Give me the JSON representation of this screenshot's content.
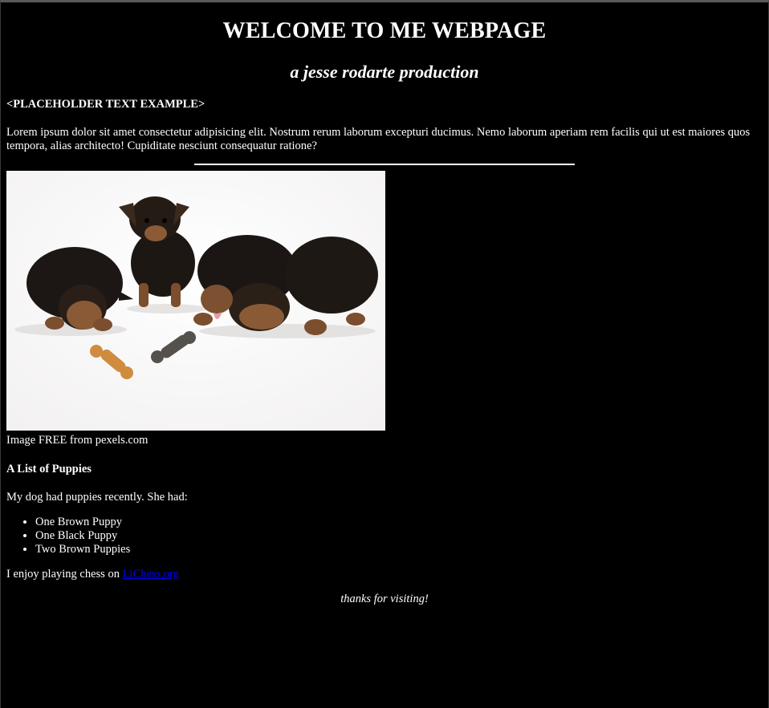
{
  "header": {
    "title": "WELCOME TO ME WEBPAGE",
    "subtitle": "a jesse rodarte production"
  },
  "placeholder": {
    "heading": "<PLACEHOLDER TEXT EXAMPLE>",
    "body": "Lorem ipsum dolor sit amet consectetur adipisicing elit. Nostrum rerum laborum excepturi ducimus. Nemo laborum aperiam rem facilis qui ut est maiores quos tempora, alias architecto! Cupiditate nesciunt consequatur ratione?"
  },
  "image": {
    "caption": "Image FREE from pexels.com"
  },
  "puppies": {
    "heading": "A List of Puppies",
    "intro": "My dog had puppies recently. She had:",
    "items": [
      "One Brown Puppy",
      "One Black Puppy",
      "Two Brown Puppies"
    ]
  },
  "chess": {
    "text": "I enjoy playing chess on ",
    "link_label": "LiChess.org",
    "link_color": "#0000ee"
  },
  "footer": {
    "thanks": "thanks for visiting!"
  },
  "colors": {
    "background": "#000000",
    "text": "#ffffff"
  }
}
